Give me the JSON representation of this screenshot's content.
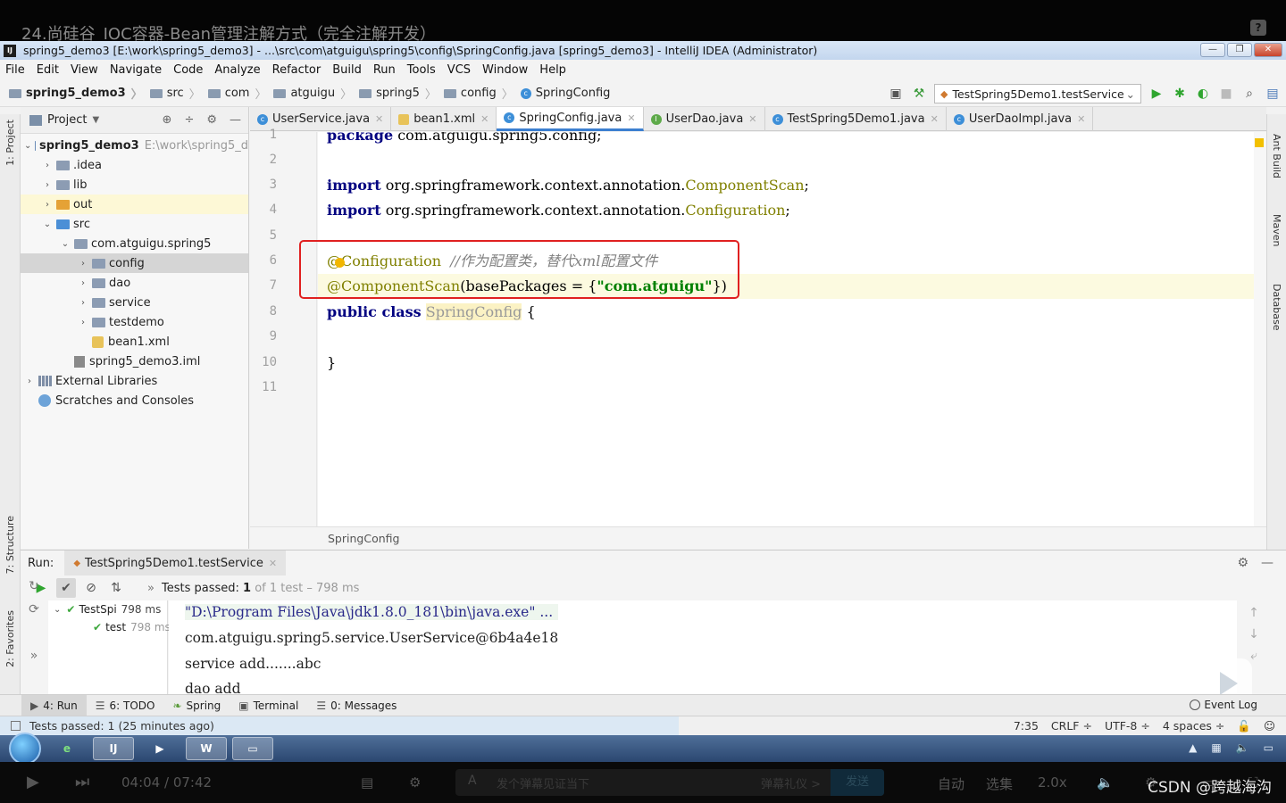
{
  "video": {
    "title": "24.尚硅谷_IOC容器-Bean管理注解方式（完全注解开发）",
    "time": "04:04 / 07:42",
    "danmu_placeholder": "发个弹幕见证当下",
    "danmu_etiquette": "弹幕礼仪 >",
    "send": "发送",
    "auto": "自动",
    "episodes": "选集",
    "speed": "2.0x",
    "watermark": "CSDN @跨越海沟"
  },
  "window": {
    "title": "spring5_demo3 [E:\\work\\spring5_demo3] - ...\\src\\com\\atguigu\\spring5\\config\\SpringConfig.java [spring5_demo3] - IntelliJ IDEA (Administrator)",
    "app_icon": "IJ"
  },
  "menu": [
    "File",
    "Edit",
    "View",
    "Navigate",
    "Code",
    "Analyze",
    "Refactor",
    "Build",
    "Run",
    "Tools",
    "VCS",
    "Window",
    "Help"
  ],
  "breadcrumbs": [
    "spring5_demo3",
    "src",
    "com",
    "atguigu",
    "spring5",
    "config",
    "SpringConfig"
  ],
  "run_config": "TestSpring5Demo1.testService",
  "side_labels": {
    "project": "1: Project",
    "structure": "7: Structure",
    "favorites": "2: Favorites",
    "ant": "Ant Build",
    "maven": "Maven",
    "database": "Database"
  },
  "project_panel": {
    "title": "Project",
    "tree": [
      {
        "label": "spring5_demo3",
        "extra": "E:\\work\\spring5_d",
        "arrow": "⌄"
      },
      {
        "label": ".idea",
        "arrow": "›"
      },
      {
        "label": "lib",
        "arrow": "›"
      },
      {
        "label": "out",
        "arrow": "›"
      },
      {
        "label": "src",
        "arrow": "⌄"
      },
      {
        "label": "com.atguigu.spring5",
        "arrow": "⌄"
      },
      {
        "label": "config",
        "arrow": "›"
      },
      {
        "label": "dao",
        "arrow": "›"
      },
      {
        "label": "service",
        "arrow": "›"
      },
      {
        "label": "testdemo",
        "arrow": "›"
      },
      {
        "label": "bean1.xml"
      },
      {
        "label": "spring5_demo3.iml"
      },
      {
        "label": "External Libraries",
        "arrow": "›"
      },
      {
        "label": "Scratches and Consoles"
      }
    ]
  },
  "editor_tabs": [
    "UserService.java",
    "bean1.xml",
    "SpringConfig.java",
    "UserDao.java",
    "TestSpring5Demo1.java",
    "UserDaoImpl.java"
  ],
  "code": {
    "line_numbers": [
      "1",
      "2",
      "3",
      "4",
      "5",
      "6",
      "7",
      "8",
      "9",
      "10",
      "11"
    ],
    "l1_kw": "package",
    "l1_rest": "com.atguigu.spring5.config;",
    "l3_kw": "import",
    "l3_pkg": "org.springframework.context.annotation.",
    "l3_cls": "ComponentScan",
    "l3_end": ";",
    "l4_kw": "import",
    "l4_pkg": "org.springframework.context.annotation.",
    "l4_cls": "Configuration",
    "l4_end": ";",
    "l6_at": "@",
    "l6_ann": "Configuration",
    "l6_comment": "//作为配置类，替代xml配置文件",
    "l7_ann": "@ComponentScan",
    "l7_args": "(basePackages = {",
    "l7_str": "\"com.atguigu\"",
    "l7_end": "})",
    "l8_kw": "public class",
    "l8_name": "SpringConfig",
    "l8_brace": "{",
    "l10_brace": "}"
  },
  "editor_breadcrumb": "SpringConfig",
  "run": {
    "label": "Run:",
    "tab": "TestSpring5Demo1.testService",
    "passed_label": "Tests passed:",
    "passed_count": "1",
    "passed_rest": "of 1 test – 798 ms",
    "tests": [
      {
        "name": "TestSpi",
        "time": "798 ms"
      },
      {
        "name": "test",
        "time": "798 ms"
      }
    ],
    "output": [
      "\"D:\\Program Files\\Java\\jdk1.8.0_181\\bin\\java.exe\" ...",
      "com.atguigu.spring5.service.UserService@6b4a4e18",
      "service add.......abc",
      "dao add"
    ]
  },
  "bottom_tabs": [
    "4: Run",
    "6: TODO",
    "Spring",
    "Terminal",
    "0: Messages"
  ],
  "event_log": "Event Log",
  "status": {
    "message": "Tests passed: 1 (25 minutes ago)",
    "position": "7:35",
    "line_sep": "CRLF ÷",
    "encoding": "UTF-8 ÷",
    "indent": "4 spaces ÷"
  },
  "taskbar_apps": [
    "e",
    "IJ",
    "▶",
    "W",
    "▭"
  ]
}
